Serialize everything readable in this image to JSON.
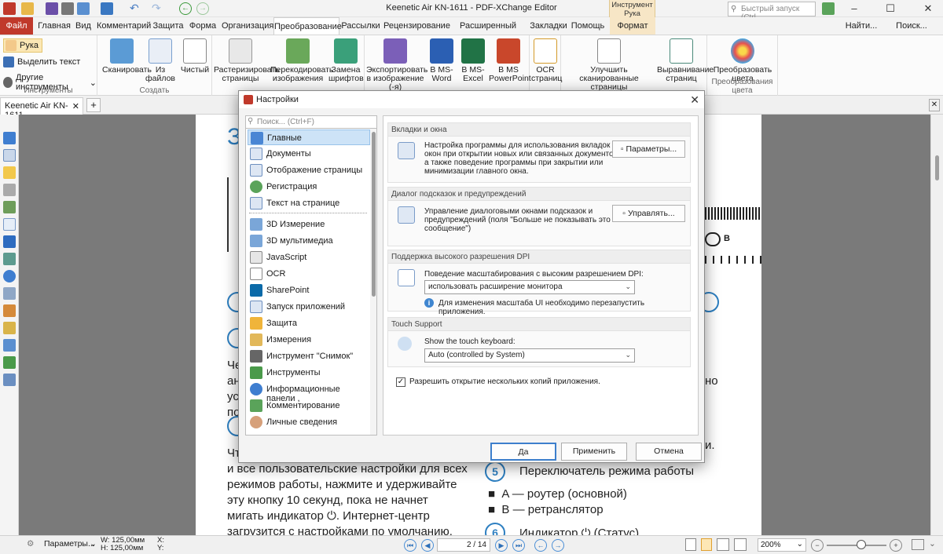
{
  "window": {
    "title": "Keenetic Air KN-1611 - PDF-XChange Editor",
    "context_tab_group": "Инструмент Рука",
    "quick_search_placeholder": "Быстрый запуск (Ctrl...",
    "find_label": "Найти...",
    "search_label": "Поиск..."
  },
  "ribbon_tabs": [
    "Файл",
    "Главная",
    "Вид",
    "Комментарий",
    "Защита",
    "Форма",
    "Организация",
    "Преобразование",
    "Рассылки",
    "Рецензирование",
    "Расширенный доступ",
    "Закладки",
    "Помощь",
    "Формат"
  ],
  "ribbon": {
    "tools_group": {
      "hand": "Рука",
      "select_text": "Выделить текст",
      "other_tools": "Другие инструменты",
      "label": "Инструменты"
    },
    "create_group": {
      "scan": "Сканировать",
      "from_files": "Из файлов",
      "blank": "Чистый",
      "label": "Создать"
    },
    "convert_buttons": [
      "Растеризировать страницы",
      "Перекодировать изображения",
      "Замена шрифтов",
      "Экспортировать в изображение (-я)",
      "В MS-Word",
      "В MS-Excel",
      "В MS PowerPoint",
      "OCR страниц",
      "Улучшить сканированные страницы",
      "Выравнивание страниц",
      "Преобразовать цвета"
    ],
    "convert_colors_label": "Преобразования цвета"
  },
  "doc_tab": "Keenetic Air KN-1611",
  "document": {
    "left_column": [
      "и все пользовательские настройки для всех",
      "режимов работы, нажмите и удерживайте",
      "эту кнопку 10 секунд, пока не начнет",
      "мигать индикатор ⏻. Интернет-центр",
      "загрузится с настройками по умолчанию."
    ],
    "right_heading_num": "5",
    "right_heading": "Переключатель режима работы",
    "right_items": [
      "A — роутер (основной)",
      "B — ретранслятор"
    ],
    "right_bottom_num": "6",
    "right_bottom": "Индикатор ⏻ (Статус)"
  },
  "dialog": {
    "title": "Настройки",
    "search_placeholder": "Поиск... (Ctrl+F)",
    "categories": [
      "Главные",
      "Документы",
      "Отображение страницы",
      "Регистрация",
      "Текст на странице",
      "3D Измерение",
      "3D мультимедиа",
      "JavaScript",
      "OCR",
      "SharePoint",
      "Запуск приложений",
      "Защита",
      "Измерения",
      "Инструмент \"Снимок\"",
      "Инструменты",
      "Информационные панели ,",
      "Комментирование",
      "Личные сведения"
    ],
    "sections": {
      "tabs": {
        "header": "Вкладки и окна",
        "text": [
          "Настройка программы для использования вкладок и",
          "окон при открытии новых или связанных документов,",
          "а также поведение программы при закрытии или",
          "минимизации главного окна."
        ],
        "button": "Параметры..."
      },
      "hints": {
        "header": "Диалог подсказок и предупреждений",
        "text": [
          "Управление диалоговыми окнами подсказок и",
          "предупреждений (поля \"Больше не показывать это",
          "сообщение\")"
        ],
        "button": "Управлять..."
      },
      "dpi": {
        "header": "Поддержка высокого разрешения DPI",
        "label": "Поведение масштабирования с высоким разрешением DPI:",
        "value": "использовать расширение монитора",
        "note": "Для изменения масштаба UI необходимо перезапустить приложения."
      },
      "touch": {
        "header": "Touch Support",
        "label": "Show the touch keyboard:",
        "value": "Auto (controlled by System)"
      },
      "multi": {
        "label": "Разрешить открытие нескольких копий приложения.",
        "checked": true
      }
    },
    "buttons": {
      "ok": "Да",
      "apply": "Применить",
      "cancel": "Отмена"
    }
  },
  "status": {
    "options": "Параметры...",
    "width": "W: 125,00мм",
    "height": "H: 125,00мм",
    "x": "X:",
    "y": "Y:",
    "page": "2 / 14",
    "zoom": "200%"
  }
}
